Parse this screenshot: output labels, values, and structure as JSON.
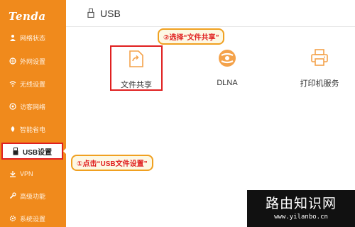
{
  "brand": {
    "logo": "Tenda"
  },
  "sidebar": {
    "items": [
      {
        "label": "网络状态",
        "icon": "network-status-icon"
      },
      {
        "label": "外网设置",
        "icon": "globe-icon"
      },
      {
        "label": "无线设置",
        "icon": "wifi-icon"
      },
      {
        "label": "访客网络",
        "icon": "guest-icon"
      },
      {
        "label": "智能省电",
        "icon": "power-save-icon"
      },
      {
        "label": "USB设置",
        "icon": "usb-icon",
        "active": true
      },
      {
        "label": "VPN",
        "icon": "vpn-icon"
      },
      {
        "label": "高级功能",
        "icon": "wrench-icon"
      },
      {
        "label": "系统设置",
        "icon": "gear-icon"
      }
    ]
  },
  "header": {
    "title": "USB",
    "icon": "usb-icon"
  },
  "tiles": [
    {
      "label": "文件共享",
      "icon": "file-share-icon",
      "selected": true
    },
    {
      "label": "DLNA",
      "icon": "dlna-icon"
    },
    {
      "label": "打印机服务",
      "icon": "printer-icon"
    }
  ],
  "callouts": {
    "step2": "②选择“文件共享”",
    "step1": "①点击“USB文件设置”"
  },
  "watermark": {
    "title": "路由知识网",
    "url": "www.yilanbo.cn"
  },
  "colors": {
    "sidebar": "#f08a1c",
    "highlight": "#e02020",
    "callout_border": "#f0a020"
  }
}
